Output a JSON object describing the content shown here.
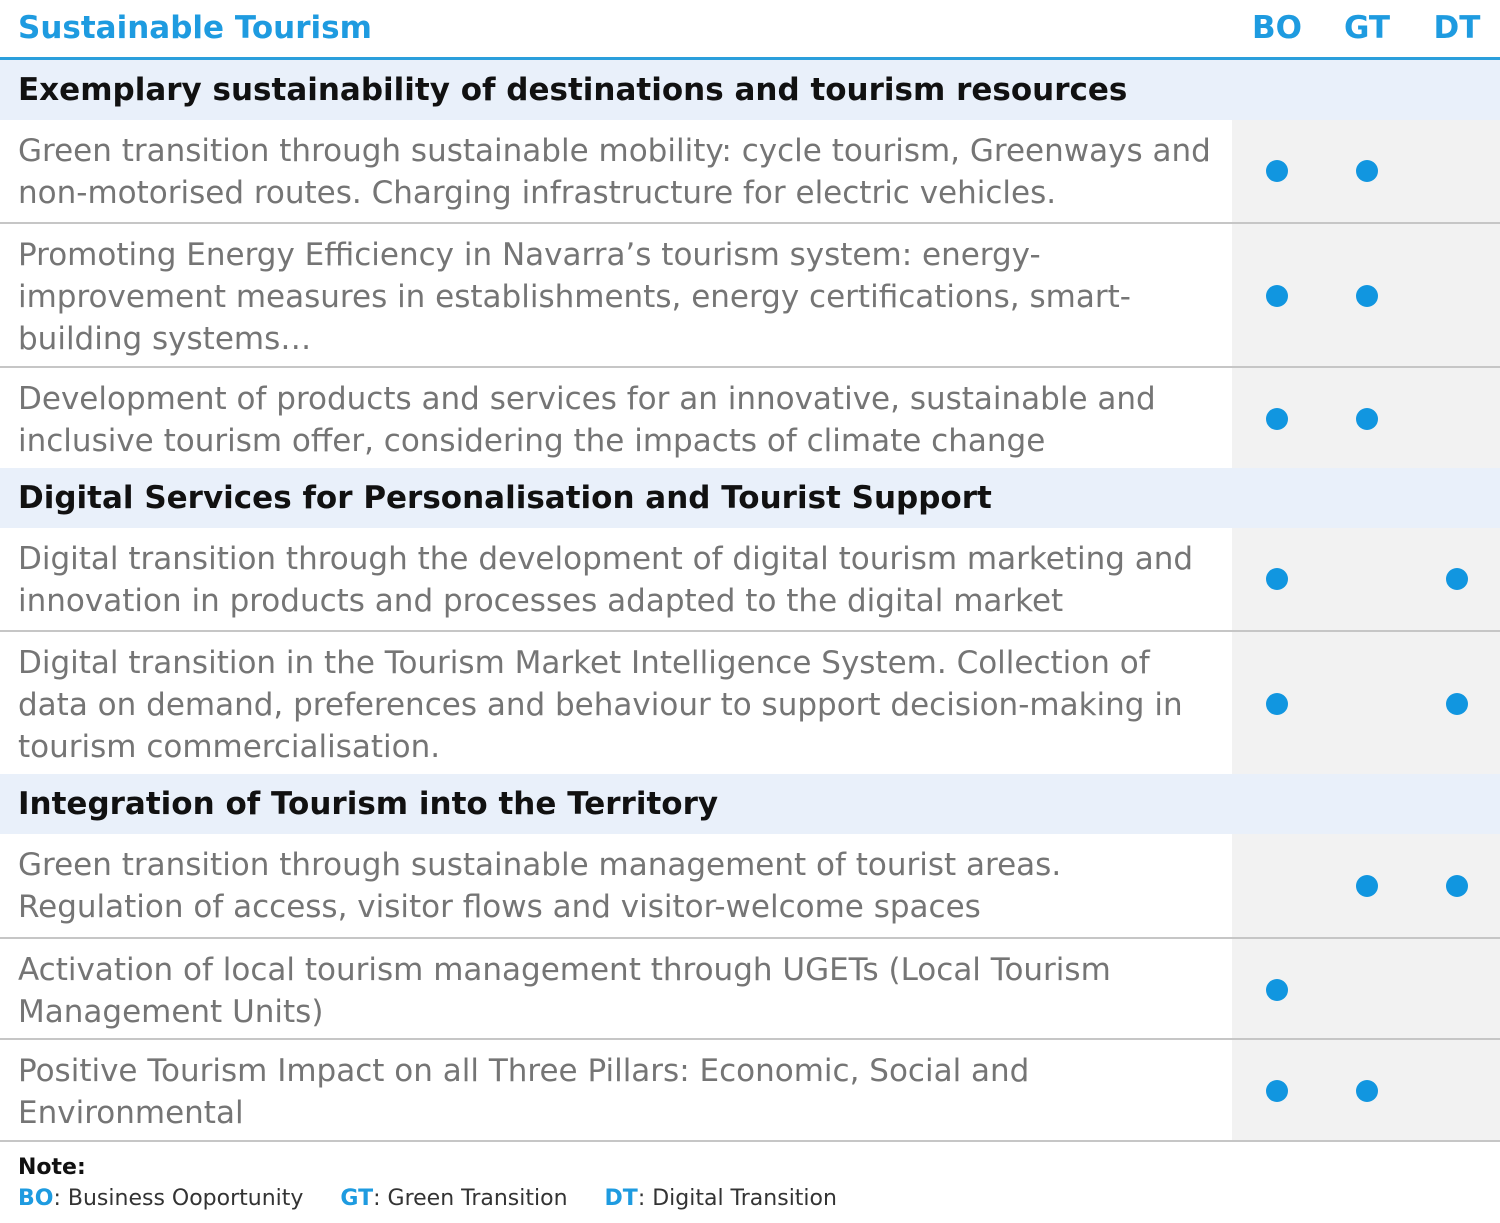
{
  "header": {
    "title": "Sustainable Tourism",
    "columns": [
      "BO",
      "GT",
      "DT"
    ]
  },
  "sections": [
    {
      "title": "Exemplary sustainability of destinations and tourism resources",
      "rows": [
        {
          "text": "Green transition through sustainable mobility: cycle tourism, Greenways and non-motorised routes. Charging infrastructure for electric vehicles.",
          "BO": true,
          "GT": true,
          "DT": false
        },
        {
          "text": "Promoting Energy Efficiency in Navarra’s tourism system: energy-improvement measures in establishments, energy certifications, smart-building systems…",
          "BO": true,
          "GT": true,
          "DT": false
        },
        {
          "text": "Development of products and services for an innovative, sustainable and inclusive tourism offer, considering the impacts of climate change",
          "BO": true,
          "GT": true,
          "DT": false
        }
      ]
    },
    {
      "title": "Digital Services for Personalisation and Tourist Support",
      "rows": [
        {
          "text": "Digital transition through the development of digital tourism marketing and innovation in products and processes adapted to the digital market",
          "BO": true,
          "GT": false,
          "DT": true
        },
        {
          "text": "Digital transition in the Tourism Market Intelligence System. Collection of data on demand, preferences and behaviour to support decision-making in tourism commercialisation.",
          "BO": true,
          "GT": false,
          "DT": true
        }
      ]
    },
    {
      "title": "Integration of Tourism into the Territory",
      "rows": [
        {
          "text": "Green transition through sustainable management of tourist areas. Regulation of access, visitor flows and visitor-welcome spaces",
          "BO": false,
          "GT": true,
          "DT": true
        },
        {
          "text": "Activation of local tourism management through UGETs (Local Tourism Management Units)",
          "BO": true,
          "GT": false,
          "DT": false
        },
        {
          "text": "Positive Tourism Impact on all Three Pillars: Economic, Social and Environmental",
          "BO": true,
          "GT": true,
          "DT": false
        }
      ]
    }
  ],
  "note": {
    "title": "Note:",
    "legend": [
      {
        "abbr": "BO",
        "label": ": Business Ooportunity"
      },
      {
        "abbr": "GT",
        "label": ": Green Transition"
      },
      {
        "abbr": "DT",
        "label": ": Digital Transition"
      }
    ]
  },
  "colors": {
    "accent": "#1e9be0",
    "dot": "#1196e0",
    "section_bg": "#e9f0fa",
    "marker_column_bg": "#f2f2f2",
    "body_text": "#757575"
  }
}
